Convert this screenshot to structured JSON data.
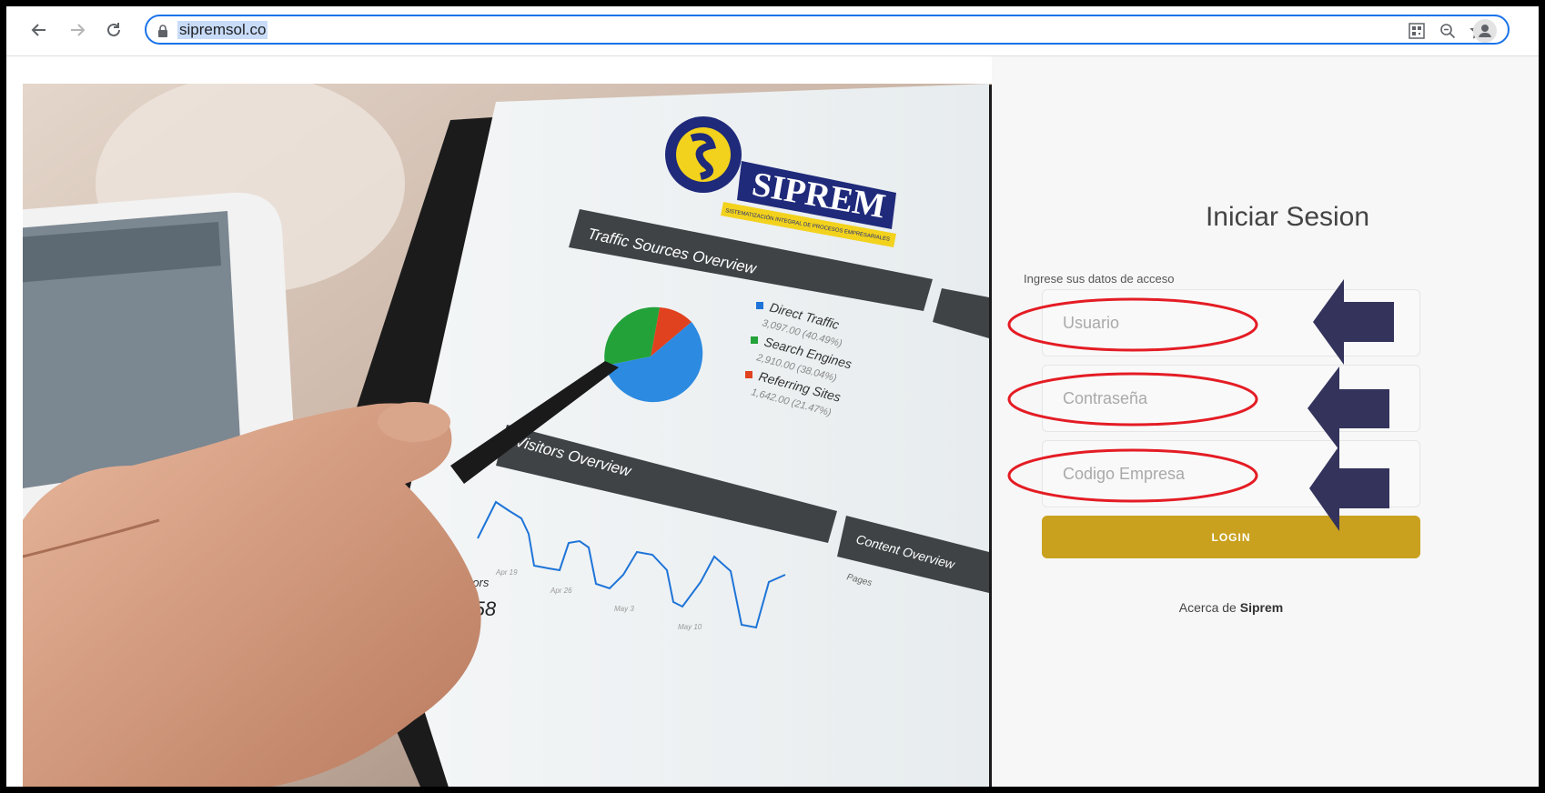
{
  "browser": {
    "url": "sipremsol.co"
  },
  "hero": {
    "logo_text": "SIPREM",
    "logo_tagline": "SISTEMATIZACIÓN INTEGRAL DE PROCESOS EMPRESARIALES",
    "panel_title_1": "Traffic Sources Overview",
    "panel_title_2": "Visitors Overview",
    "legend": [
      {
        "label": "Direct Traffic",
        "value": "3,097.00 (40.49%)",
        "color": "#1e74d8"
      },
      {
        "label": "Search Engines",
        "value": "2,910.00 (38.04%)",
        "color": "#23a23a"
      },
      {
        "label": "Referring Sites",
        "value": "1,642.00 (21.47%)",
        "color": "#e0411e"
      }
    ],
    "visitors_label": "Visitors",
    "visitors_value": "2,958",
    "axis_dates": [
      "Apr 19",
      "Apr 26",
      "May 3",
      "May 10"
    ],
    "content_overview": "Content Overview",
    "pages_label": "Pages"
  },
  "login": {
    "title": "Iniciar Sesion",
    "hint": "Ingrese sus datos de acceso",
    "user_placeholder": "Usuario",
    "password_placeholder": "Contraseña",
    "company_placeholder": "Codigo Empresa",
    "login_label": "LOGIN",
    "about_prefix": "Acerca de",
    "about_brand": "Siprem"
  },
  "colors": {
    "accent": "#c9a11f",
    "annotation_ellipse": "#e41c24",
    "annotation_arrow": "#33335c"
  }
}
